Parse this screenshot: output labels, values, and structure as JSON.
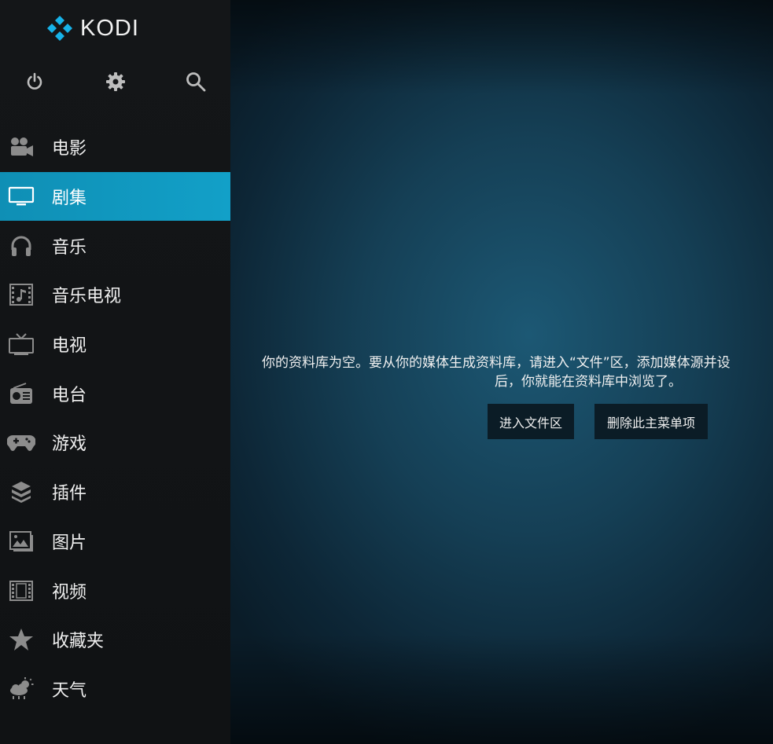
{
  "app": {
    "name": "KODI"
  },
  "colors": {
    "accent": "#12a0c8",
    "sidebar": "#141618",
    "background": "#153f55",
    "button": "#0b1c26"
  },
  "top_icons": [
    "power-icon",
    "gear-icon",
    "search-icon"
  ],
  "menu": {
    "items": [
      {
        "label": "电影",
        "icon": "movie-camera-icon",
        "active": false
      },
      {
        "label": "剧集",
        "icon": "tv-monitor-icon",
        "active": true
      },
      {
        "label": "音乐",
        "icon": "headphones-icon",
        "active": false
      },
      {
        "label": "音乐电视",
        "icon": "music-video-icon",
        "active": false
      },
      {
        "label": "电视",
        "icon": "tv-icon",
        "active": false
      },
      {
        "label": "电台",
        "icon": "radio-icon",
        "active": false
      },
      {
        "label": "游戏",
        "icon": "gamepad-icon",
        "active": false
      },
      {
        "label": "插件",
        "icon": "addons-box-icon",
        "active": false
      },
      {
        "label": "图片",
        "icon": "pictures-icon",
        "active": false
      },
      {
        "label": "视频",
        "icon": "film-strip-icon",
        "active": false
      },
      {
        "label": "收藏夹",
        "icon": "star-icon",
        "active": false
      },
      {
        "label": "天气",
        "icon": "weather-icon",
        "active": false
      }
    ]
  },
  "main": {
    "message_line1": "你的资料库为空。要从你的媒体生成资料库，请进入“文件”区，添加媒体源并设",
    "message_line2": "后，你就能在资料库中浏览了。",
    "button_files": "进入文件区",
    "button_remove": "删除此主菜单项"
  }
}
